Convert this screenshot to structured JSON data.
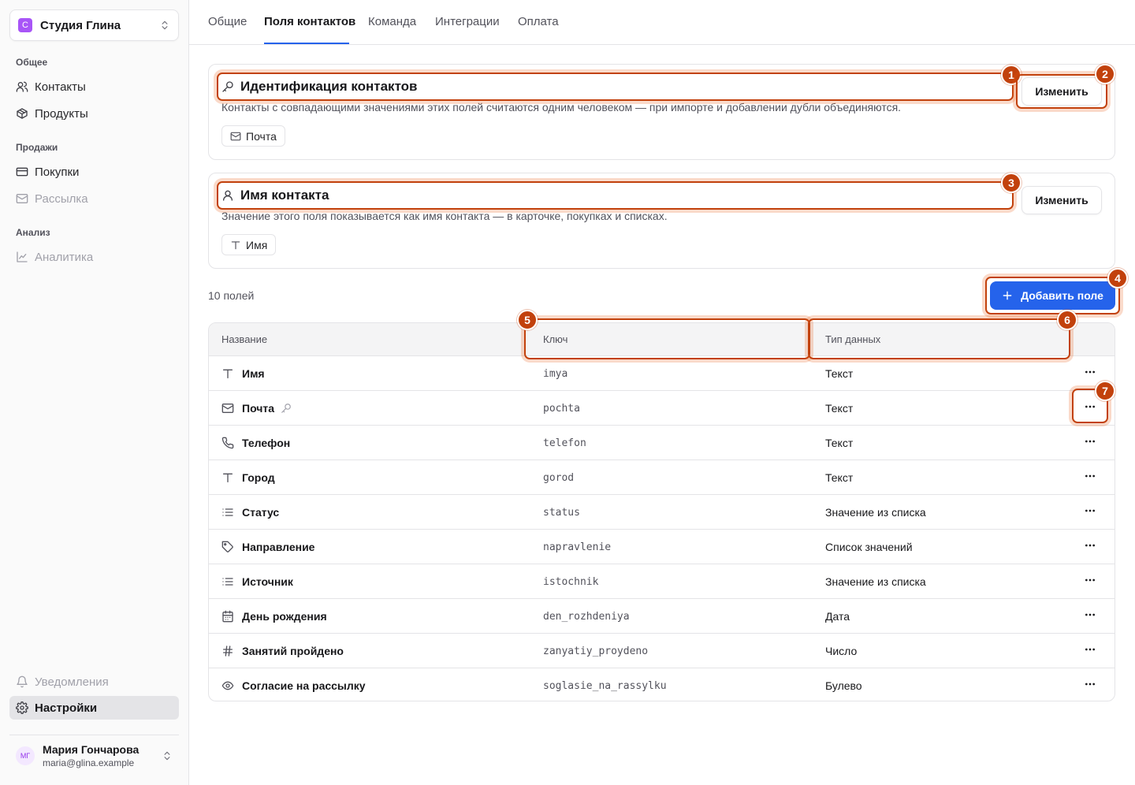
{
  "workspace": {
    "logo_letter": "С",
    "name": "Студия Глина"
  },
  "sidebar": {
    "sections": [
      {
        "title": "Общее",
        "items": [
          {
            "label": "Контакты",
            "icon": "users-icon"
          },
          {
            "label": "Продукты",
            "icon": "box-icon"
          }
        ]
      },
      {
        "title": "Продажи",
        "items": [
          {
            "label": "Покупки",
            "icon": "credit-card-icon"
          },
          {
            "label": "Рассылка",
            "icon": "mail-icon",
            "muted": true
          }
        ]
      },
      {
        "title": "Анализ",
        "items": [
          {
            "label": "Аналитика",
            "icon": "chart-line-icon",
            "muted": true
          }
        ]
      }
    ],
    "bottom": [
      {
        "label": "Уведомления",
        "icon": "bell-icon",
        "muted": true
      },
      {
        "label": "Настройки",
        "icon": "gear-icon",
        "active": true
      }
    ],
    "user": {
      "initials": "МГ",
      "name": "Мария Гончарова",
      "email": "maria@glina.example"
    }
  },
  "tabs": {
    "items": [
      "Общие",
      "Поля контактов",
      "Команда",
      "Интеграции",
      "Оплата"
    ],
    "active_index": 1
  },
  "identity_card": {
    "title": "Идентификация контактов",
    "description": "Контакты с совпадающими значениями этих полей считаются одним человеком — при импорте и добавлении дубли объединяются.",
    "chip": "Почта",
    "button": "Изменить"
  },
  "name_card": {
    "title": "Имя контакта",
    "description": "Значение этого поля показывается как имя контакта — в карточке, покупках и списках.",
    "chip": "Имя",
    "button": "Изменить"
  },
  "fields": {
    "count_label": "10 полей",
    "add_button": "Добавить поле",
    "columns": {
      "name": "Название",
      "key": "Ключ",
      "type": "Тип данных"
    },
    "rows": [
      {
        "name": "Имя",
        "key": "imya",
        "type": "Текст",
        "icon": "text-icon"
      },
      {
        "name": "Почта",
        "key": "pochta",
        "type": "Текст",
        "icon": "mail-icon",
        "identity_key": true
      },
      {
        "name": "Телефон",
        "key": "telefon",
        "type": "Текст",
        "icon": "phone-icon"
      },
      {
        "name": "Город",
        "key": "gorod",
        "type": "Текст",
        "icon": "text-icon"
      },
      {
        "name": "Статус",
        "key": "status",
        "type": "Значение из списка",
        "icon": "list-icon"
      },
      {
        "name": "Направление",
        "key": "napravlenie",
        "type": "Список значений",
        "icon": "tag-icon"
      },
      {
        "name": "Источник",
        "key": "istochnik",
        "type": "Значение из списка",
        "icon": "list-icon"
      },
      {
        "name": "День рождения",
        "key": "den_rozhdeniya",
        "type": "Дата",
        "icon": "calendar-icon"
      },
      {
        "name": "Занятий пройдено",
        "key": "zanyatiy_proydeno",
        "type": "Число",
        "icon": "hash-icon"
      },
      {
        "name": "Согласие на рассылку",
        "key": "soglasie_na_rassylku",
        "type": "Булево",
        "icon": "eye-icon"
      }
    ]
  },
  "annotations": [
    "1",
    "2",
    "3",
    "4",
    "5",
    "6",
    "7"
  ],
  "colors": {
    "accent": "#2563eb",
    "annotation": "#c2410c",
    "workspace_logo": "#a855f7"
  }
}
